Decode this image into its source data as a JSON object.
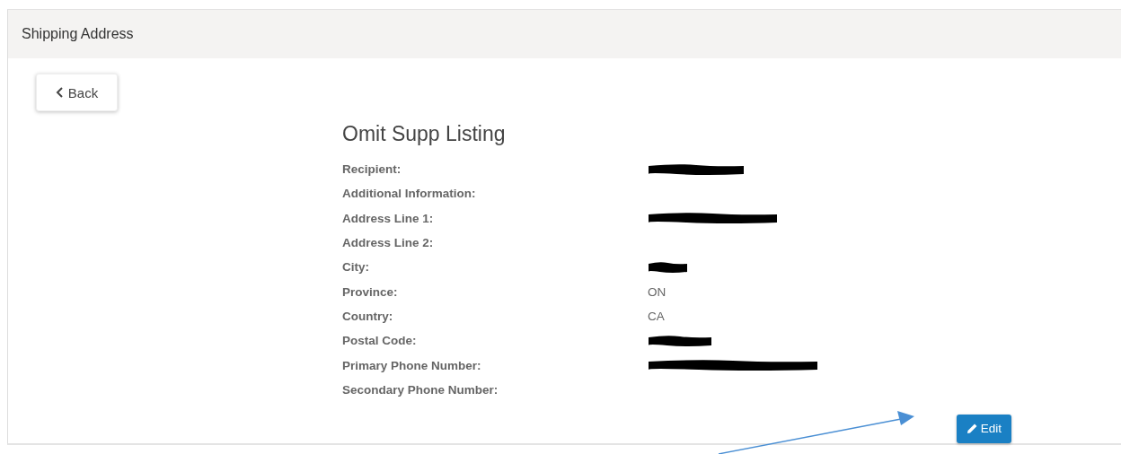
{
  "panel": {
    "title": "Shipping Address"
  },
  "back_button": {
    "label": "Back"
  },
  "listing": {
    "title": "Omit Supp Listing",
    "fields": [
      {
        "label": "Recipient:",
        "redacted": true
      },
      {
        "label": "Additional Information:",
        "redacted": false
      },
      {
        "label": "Address Line 1:",
        "redacted": true
      },
      {
        "label": "Address Line 2:",
        "redacted": false
      },
      {
        "label": "City:",
        "redacted": true
      },
      {
        "label": "Province:",
        "value": "ON",
        "redacted": false
      },
      {
        "label": "Country:",
        "value": "CA",
        "redacted": false
      },
      {
        "label": "Postal Code:",
        "redacted": true
      },
      {
        "label": "Primary Phone Number:",
        "redacted": true
      },
      {
        "label": "Secondary Phone Number:",
        "redacted": false
      }
    ]
  },
  "edit_button": {
    "label": "Edit"
  },
  "annotation": {
    "kind": "arrow"
  }
}
